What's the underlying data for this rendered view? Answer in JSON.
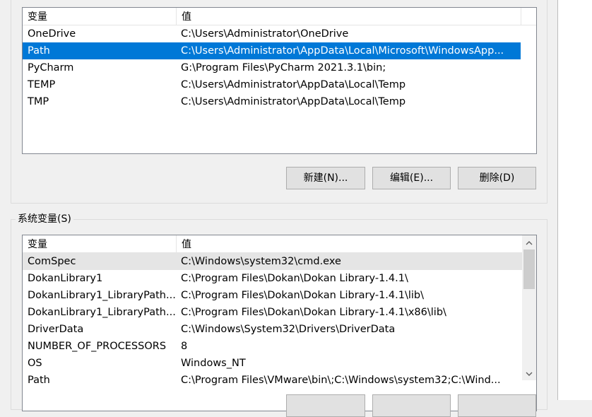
{
  "user_vars": {
    "col_name": "变量",
    "col_value": "值",
    "rows": [
      {
        "name": "OneDrive",
        "value": "C:\\Users\\Administrator\\OneDrive"
      },
      {
        "name": "Path",
        "value": "C:\\Users\\Administrator\\AppData\\Local\\Microsoft\\WindowsApp..."
      },
      {
        "name": "PyCharm",
        "value": "G:\\Program Files\\PyCharm 2021.3.1\\bin;"
      },
      {
        "name": "TEMP",
        "value": "C:\\Users\\Administrator\\AppData\\Local\\Temp"
      },
      {
        "name": "TMP",
        "value": "C:\\Users\\Administrator\\AppData\\Local\\Temp"
      }
    ],
    "selected_row": "Path",
    "buttons": {
      "new": "新建(N)...",
      "edit": "编辑(E)...",
      "delete": "删除(D)"
    }
  },
  "system_vars": {
    "group_title": "系统变量(S)",
    "col_name": "变量",
    "col_value": "值",
    "rows": [
      {
        "name": "ComSpec",
        "value": "C:\\Windows\\system32\\cmd.exe"
      },
      {
        "name": "DokanLibrary1",
        "value": "C:\\Program Files\\Dokan\\Dokan Library-1.4.1\\"
      },
      {
        "name": "DokanLibrary1_LibraryPath...",
        "value": "C:\\Program Files\\Dokan\\Dokan Library-1.4.1\\lib\\"
      },
      {
        "name": "DokanLibrary1_LibraryPath...",
        "value": "C:\\Program Files\\Dokan\\Dokan Library-1.4.1\\x86\\lib\\"
      },
      {
        "name": "DriverData",
        "value": "C:\\Windows\\System32\\Drivers\\DriverData"
      },
      {
        "name": "NUMBER_OF_PROCESSORS",
        "value": "8"
      },
      {
        "name": "OS",
        "value": "Windows_NT"
      },
      {
        "name": "Path",
        "value": "C:\\Program Files\\VMware\\bin\\;C:\\Windows\\system32;C:\\Wind..."
      }
    ],
    "hover_row": "ComSpec",
    "scroll": {
      "up_icon": "chevron-up-icon",
      "down_icon": "chevron-down-icon"
    }
  },
  "colors": {
    "selection": "#0078d7",
    "hover": "#e5e5e5"
  }
}
